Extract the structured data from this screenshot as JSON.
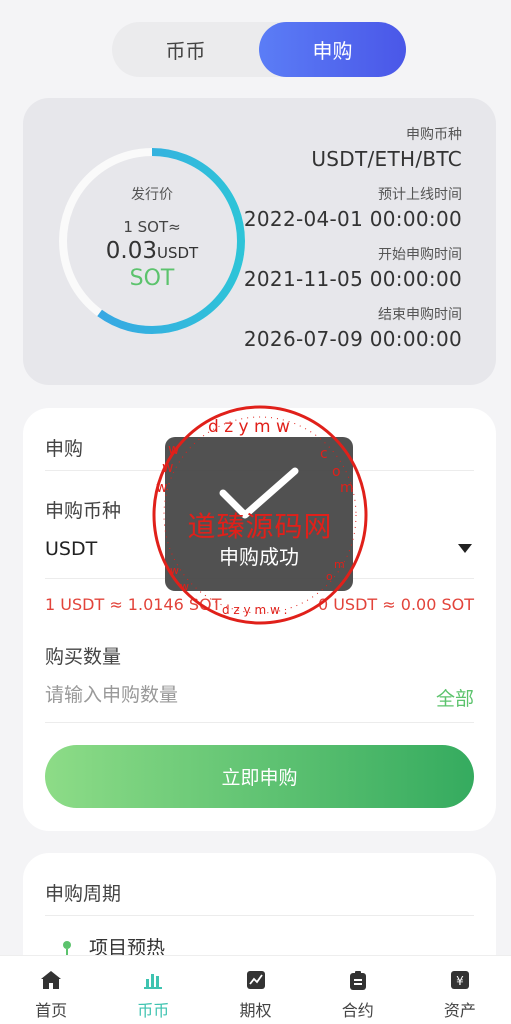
{
  "segment": {
    "tabs": [
      "币币",
      "申购"
    ],
    "active": 1
  },
  "info": {
    "ring": {
      "label": "发行价",
      "rate": "1 SOT≈",
      "price": "0.03",
      "price_unit": "USDT",
      "coin": "SOT",
      "progress": 0.6
    },
    "fields": [
      {
        "label": "申购币种",
        "value": "USDT/ETH/BTC"
      },
      {
        "label": "预计上线时间",
        "value": "2022-04-01 00:00:00"
      },
      {
        "label": "开始申购时间",
        "value": "2021-11-05 00:00:00"
      },
      {
        "label": "结束申购时间",
        "value": "2026-07-09 00:00:00"
      }
    ]
  },
  "form": {
    "title": "申购",
    "coin_label": "申购币种",
    "coin_value": "USDT",
    "rate_left": "1 USDT ≈ 1.0146 SOT",
    "rate_right": "0 USDT ≈ 0.00 SOT",
    "qty_label": "购买数量",
    "qty_placeholder": "请输入申购数量",
    "all_label": "全部",
    "submit_label": "立即申购"
  },
  "period": {
    "title": "申购周期",
    "steps": [
      "项目预热"
    ]
  },
  "toast": {
    "text": "申购成功"
  },
  "watermark": {
    "text": "道臻源码网",
    "ring_text": "dzymw.com"
  },
  "colors": {
    "accent_blue": "#4a57e8",
    "accent_green": "#5cc36d",
    "teal_active": "#3ec3b0",
    "warn_red": "#e2443b"
  },
  "nav": [
    {
      "label": "首页",
      "icon": "home-icon"
    },
    {
      "label": "币币",
      "icon": "bar-chart-icon",
      "active": true
    },
    {
      "label": "期权",
      "icon": "trend-chart-icon"
    },
    {
      "label": "合约",
      "icon": "clipboard-icon"
    },
    {
      "label": "资产",
      "icon": "wallet-yen-icon"
    }
  ]
}
